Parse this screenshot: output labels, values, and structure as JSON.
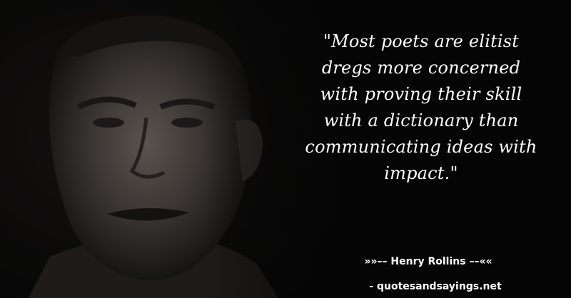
{
  "quote": {
    "text": "\"Most poets are elitist dregs more concerned with proving their skill with a dictionary than communicating ideas with impact.\"",
    "lines": [
      "\"Most poets are elitist",
      "dregs more concerned",
      "with proving their skill",
      "with a dictionary than",
      "communicating ideas with",
      "impact.\""
    ]
  },
  "attribution": {
    "author_line": "»»–– Henry Rollins ––««",
    "site_line": "- quotesandsayings.net"
  },
  "colors": {
    "background": "#050505",
    "text": "#ffffff"
  },
  "image": {
    "subject_icon": "portrait-photo"
  }
}
